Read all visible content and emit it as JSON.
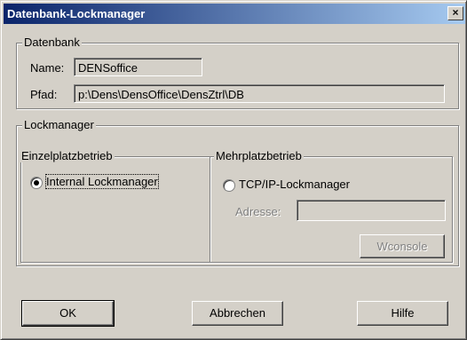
{
  "window": {
    "title": "Datenbank-Lockmanager",
    "close": "×"
  },
  "datenbank": {
    "legend": "Datenbank",
    "name_label": "Name:",
    "name_value": "DENSoffice",
    "pfad_label": "Pfad:",
    "pfad_value": "p:\\Dens\\DensOffice\\DensZtrl\\DB"
  },
  "lockmanager": {
    "legend": "Lockmanager",
    "einzel": {
      "legend": "Einzelplatzbetrieb",
      "option": "Internal Lockmanager",
      "selected": true
    },
    "mehr": {
      "legend": "Mehrplatzbetrieb",
      "option": "TCP/IP-Lockmanager",
      "selected": false,
      "adresse_label": "Adresse:",
      "adresse_value": "",
      "wconsole_label": "Wconsole"
    }
  },
  "buttons": {
    "ok": "OK",
    "abbrechen": "Abbrechen",
    "hilfe": "Hilfe"
  }
}
